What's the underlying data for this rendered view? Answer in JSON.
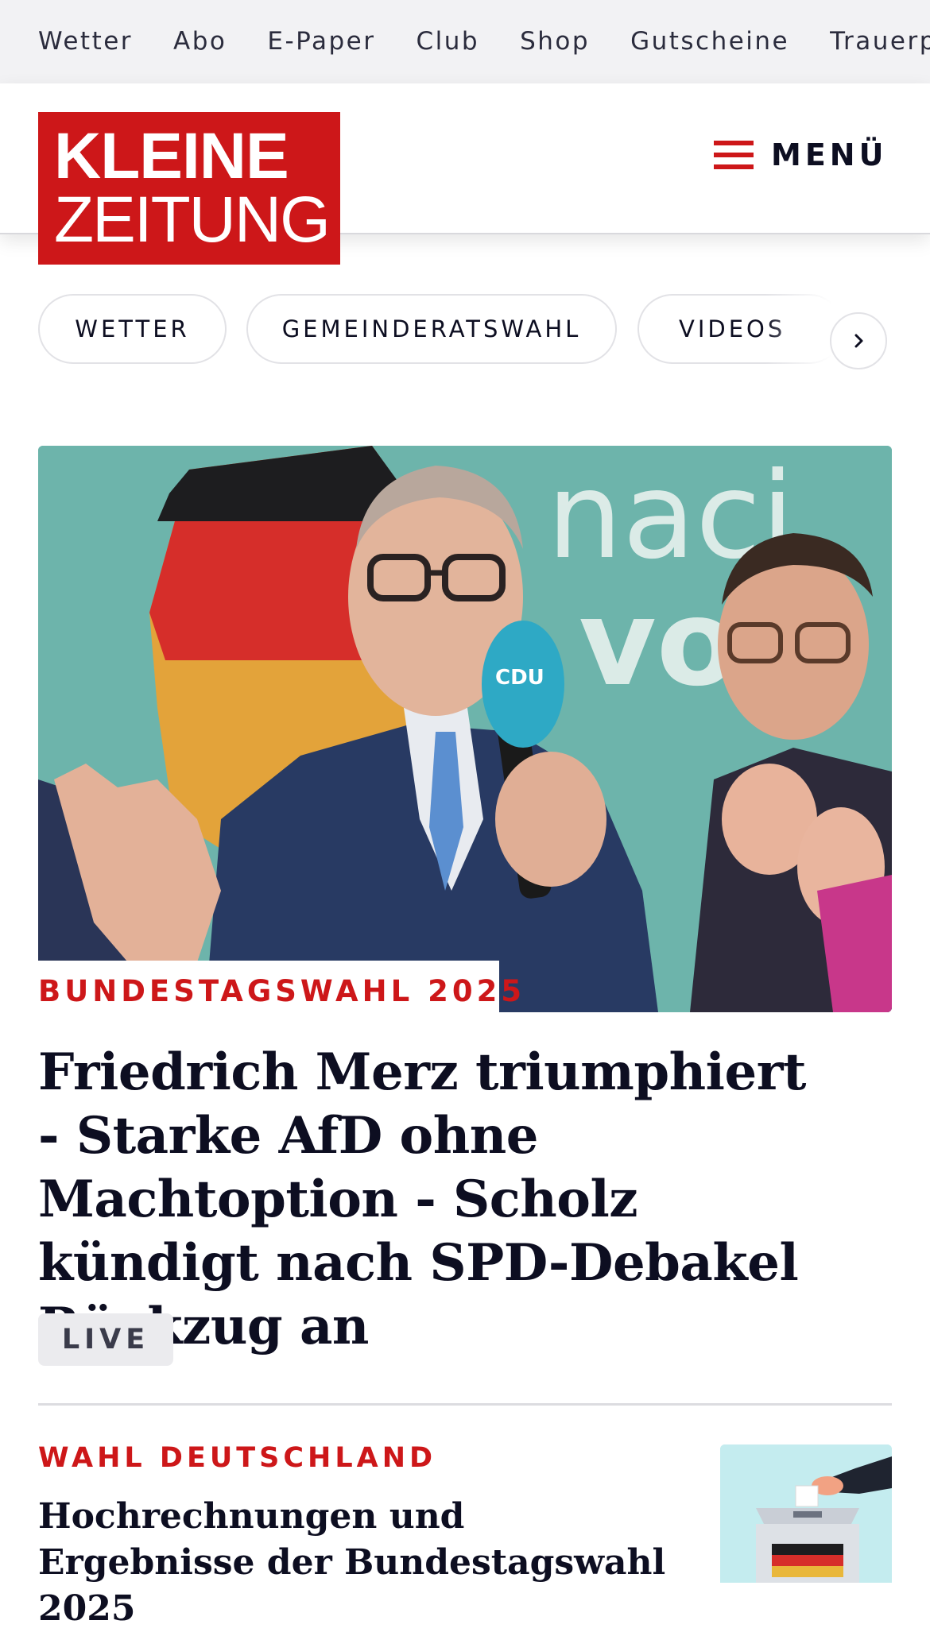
{
  "topbar": {
    "items": [
      "Wetter",
      "Abo",
      "E-Paper",
      "Club",
      "Shop",
      "Gutscheine",
      "Trauerportal"
    ]
  },
  "header": {
    "logo_line1": "KLEINE",
    "logo_line2": "ZEITUNG",
    "menu_label": "MENÜ",
    "brand_color": "#cd1719"
  },
  "chips": {
    "items": [
      "WETTER",
      "GEMEINDERATSWAHL",
      "VIDEOS"
    ],
    "next_icon": "chevron-right-icon"
  },
  "lead": {
    "image_alt": "Friedrich Merz mit CDU-Mikrofon vor Deutschlandfahne",
    "kicker": "BUNDESTAGSWAHL 2025",
    "headline": "Friedrich Merz triumphiert - Starke AfD ohne Machtoption - Scholz kündigt nach SPD-Debakel Rückzug an",
    "badge": "LIVE"
  },
  "teaser": {
    "kicker": "WAHL DEUTSCHLAND",
    "headline": "Hochrechnungen und Ergebnisse der Bundestagswahl 2025",
    "image_alt": "Wahlurne mit Deutschlandfahne"
  }
}
